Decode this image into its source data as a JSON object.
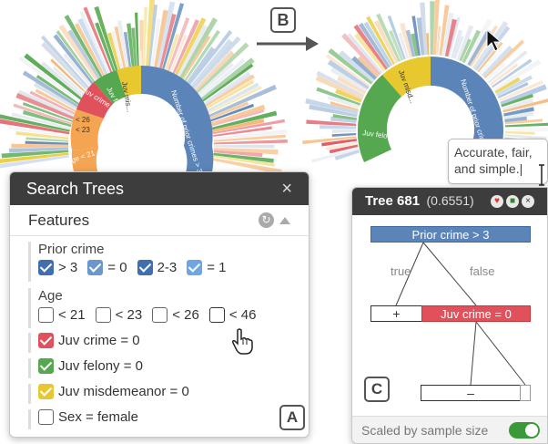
{
  "colors": {
    "prior_crime": "#5b85b8",
    "age": "#f5a451",
    "juv_crime": "#e0515b",
    "juv_felony": "#55a84f",
    "juv_misdemeanor": "#e8c82f",
    "panel_header": "#3d3d3d",
    "toggle_on": "#3a9a3a"
  },
  "markers": {
    "a": "A",
    "b": "B",
    "c": "C"
  },
  "sunburst_left": {
    "inner_labels": [
      "Number of prior crimes > 3",
      "Juv mis...",
      "Juv felo...",
      "Juv crime",
      "< 26",
      "< 23",
      "Age < 21"
    ]
  },
  "sunburst_right": {
    "inner_labels": [
      "Number of prior crimes",
      "Juv misd...",
      "Juv felo..."
    ]
  },
  "search_panel": {
    "title": "Search Trees",
    "close_icon": "×",
    "features_label": "Features",
    "groups": [
      {
        "label": "Prior crime",
        "options": [
          {
            "label": "> 3",
            "checked": true,
            "color": "#3f6fae"
          },
          {
            "label": "= 0",
            "checked": true,
            "color": "#6b97cf"
          },
          {
            "label": "2-3",
            "checked": true,
            "color": "#3f6fae"
          },
          {
            "label": "= 1",
            "checked": true,
            "color": "#6fa6e0"
          }
        ]
      },
      {
        "label": "Age",
        "options": [
          {
            "label": "< 21",
            "checked": false
          },
          {
            "label": "< 23",
            "checked": false
          },
          {
            "label": "< 26",
            "checked": false
          },
          {
            "label": "< 46",
            "checked": false
          }
        ]
      }
    ],
    "singles": [
      {
        "label": "Juv crime = 0",
        "checked": true,
        "color": "#e0515b"
      },
      {
        "label": "Juv felony = 0",
        "checked": true,
        "color": "#55a84f"
      },
      {
        "label": "Juv misdemeanor = 0",
        "checked": true,
        "color": "#e8c82f"
      },
      {
        "label": "Sex = female",
        "checked": false
      }
    ]
  },
  "tooltip": {
    "line1": "Accurate, fair,",
    "line2": "and simple.|"
  },
  "tree_panel": {
    "title": "Tree 681",
    "score": "(0.6551)",
    "root": "Prior crime > 3",
    "true_label": "true",
    "false_label": "false",
    "leaf_plus": "+",
    "juv_node": "Juv crime = 0",
    "leaf_minus": "–",
    "footer_label": "Scaled by sample size",
    "toggle_on": true
  }
}
